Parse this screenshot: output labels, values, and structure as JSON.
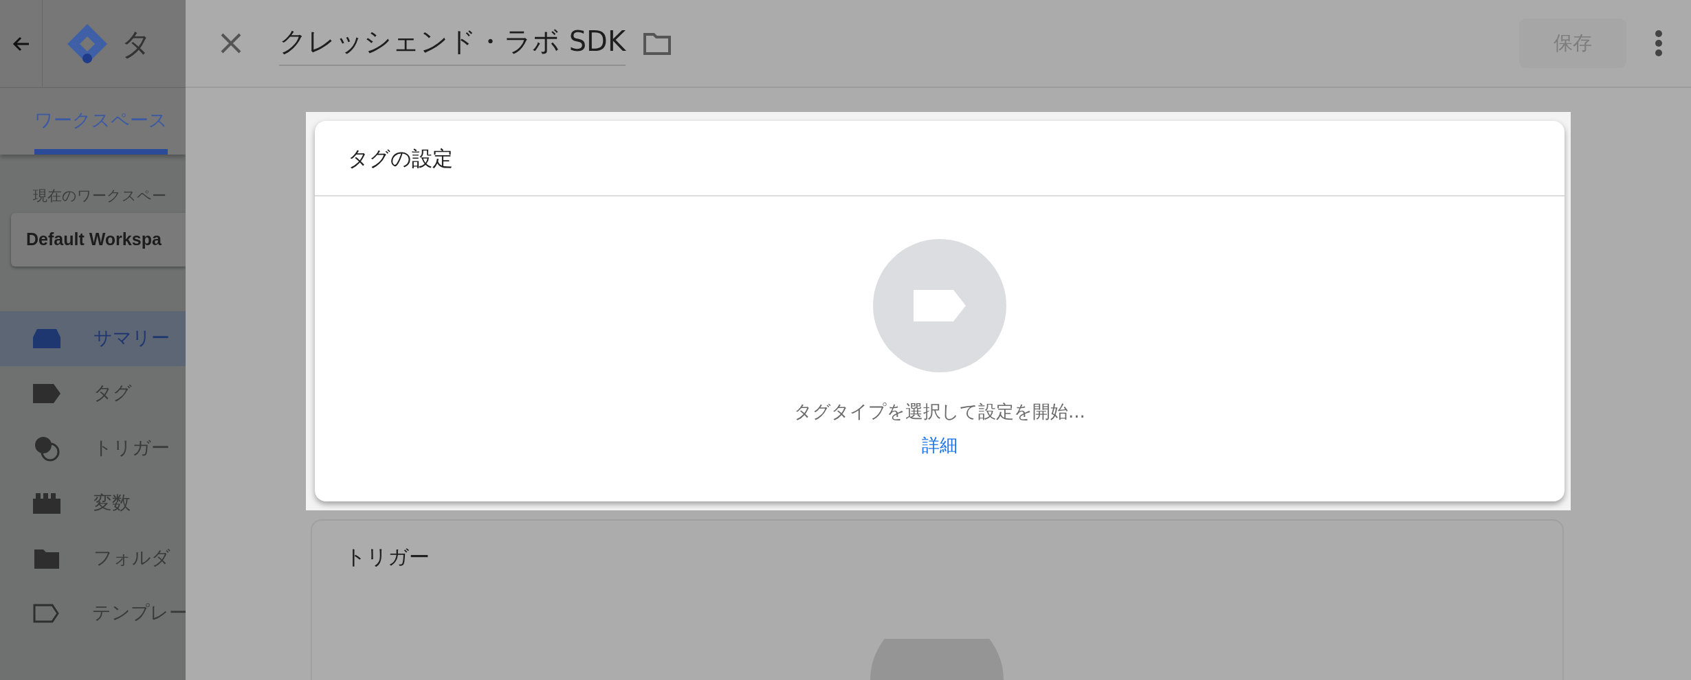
{
  "sidebar": {
    "title": "タ",
    "tabs": [
      {
        "label": "ワークスペース",
        "selected": true
      }
    ],
    "workspace_label": "現在のワークスペー",
    "workspace": "Default Workspa",
    "nav": [
      {
        "label": "サマリー",
        "selected": true
      },
      {
        "label": "タグ",
        "selected": false
      },
      {
        "label": "トリガー",
        "selected": false
      },
      {
        "label": "変数",
        "selected": false
      },
      {
        "label": "フォルダ",
        "selected": false
      },
      {
        "label": "テンプレー",
        "selected": false
      }
    ]
  },
  "editor": {
    "title": "クレッシェンド・ラボ SDK",
    "save": {
      "label": "保存",
      "disabled": true
    },
    "cards": [
      {
        "title": "タグの設定",
        "highlighted": true,
        "message": "タグタイプを選択して設定を開始...",
        "link": "詳細"
      },
      {
        "title": "トリガー",
        "highlighted": false
      }
    ]
  }
}
